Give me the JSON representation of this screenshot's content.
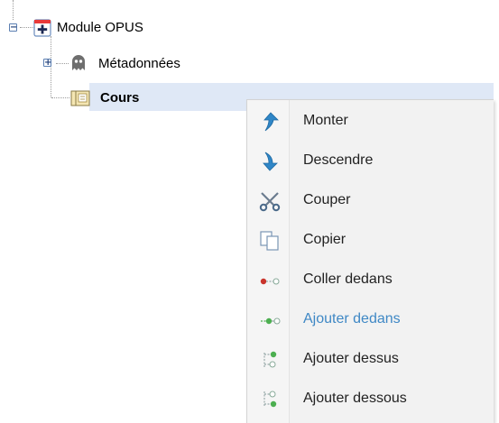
{
  "tree": {
    "root": {
      "label": "Module OPUS",
      "toggle": "−"
    },
    "children": [
      {
        "label": "Métadonnées",
        "toggle": "+"
      },
      {
        "label": "Cours",
        "selected": true
      }
    ]
  },
  "context_menu": {
    "items": [
      {
        "label": "Monter",
        "icon": "arrow-up-icon"
      },
      {
        "label": "Descendre",
        "icon": "arrow-down-icon"
      },
      {
        "label": "Couper",
        "icon": "scissors-icon"
      },
      {
        "label": "Copier",
        "icon": "copy-icon"
      },
      {
        "label": "Coller dedans",
        "icon": "paste-inside-icon"
      },
      {
        "label": "Ajouter dedans",
        "icon": "add-inside-icon",
        "highlighted": true
      },
      {
        "label": "Ajouter dessus",
        "icon": "add-above-icon"
      },
      {
        "label": "Ajouter dessous",
        "icon": "add-below-icon"
      }
    ]
  },
  "colors": {
    "selection": "#dfe8f6",
    "menu_bg": "#f2f2f2",
    "highlight_text": "#3f88c5",
    "arrow_blue": "#2f86c7"
  }
}
